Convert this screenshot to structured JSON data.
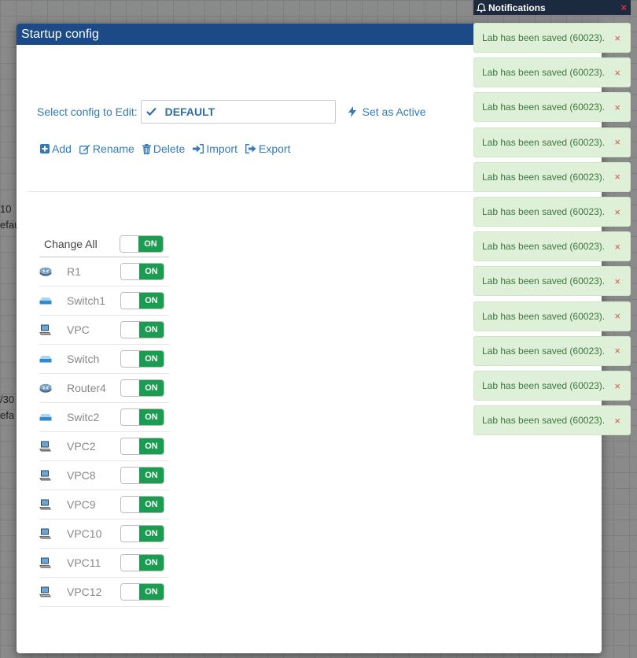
{
  "background": {
    "snippets": [
      "10 ",
      "efau",
      "/30",
      "efa"
    ]
  },
  "modal": {
    "title": "Startup config",
    "select_label": "Select config to Edit:",
    "selected_config": "DEFAULT",
    "set_active_label": "Set as Active",
    "actions": {
      "add": "Add",
      "rename": "Rename",
      "delete": "Delete",
      "import": "Import",
      "export": "Export"
    },
    "change_all_label": "Change All",
    "change_all_state": "ON",
    "nodes": [
      {
        "name": "R1",
        "icon": "router-icon",
        "state": "ON"
      },
      {
        "name": "Switch1",
        "icon": "switch-icon",
        "state": "ON"
      },
      {
        "name": "VPC",
        "icon": "pc-icon",
        "state": "ON"
      },
      {
        "name": "Switch",
        "icon": "switch-icon",
        "state": "ON"
      },
      {
        "name": "Router4",
        "icon": "router-icon",
        "state": "ON"
      },
      {
        "name": "Switc2",
        "icon": "switch-icon",
        "state": "ON"
      },
      {
        "name": "VPC2",
        "icon": "pc-icon",
        "state": "ON"
      },
      {
        "name": "VPC8",
        "icon": "pc-icon",
        "state": "ON"
      },
      {
        "name": "VPC9",
        "icon": "pc-icon",
        "state": "ON"
      },
      {
        "name": "VPC10",
        "icon": "pc-icon",
        "state": "ON"
      },
      {
        "name": "VPC11",
        "icon": "pc-icon",
        "state": "ON"
      },
      {
        "name": "VPC12",
        "icon": "pc-icon",
        "state": "ON"
      }
    ]
  },
  "notifications": {
    "title": "Notifications",
    "close_glyph": "×",
    "items": [
      "Lab has been saved (60023).",
      "Lab has been saved (60023).",
      "Lab has been saved (60023).",
      "Lab has been saved (60023).",
      "Lab has been saved (60023).",
      "Lab has been saved (60023).",
      "Lab has been saved (60023).",
      "Lab has been saved (60023).",
      "Lab has been saved (60023).",
      "Lab has been saved (60023).",
      "Lab has been saved (60023).",
      "Lab has been saved (60023)."
    ]
  },
  "colors": {
    "header_blue": "#1b4a86",
    "link_blue": "#337ab7",
    "toggle_green": "#1a9d50",
    "notif_bg": "#dff0d8",
    "notif_text": "#3c763d"
  }
}
